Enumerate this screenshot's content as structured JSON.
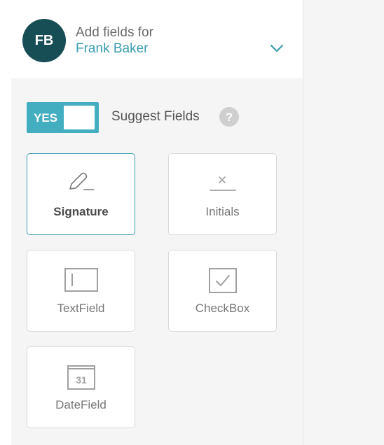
{
  "header": {
    "avatar_initials": "FB",
    "label": "Add fields for",
    "recipient_name": "Frank Baker",
    "dropdown_icon": "chevron-down-icon"
  },
  "suggest": {
    "toggle_label": "YES",
    "toggle_state": true,
    "label": "Suggest Fields",
    "help_icon_glyph": "?"
  },
  "fields": [
    {
      "label": "Signature",
      "icon": "signature-pen-icon",
      "selected": true
    },
    {
      "label": "Initials",
      "icon": "initials-icon",
      "selected": false
    },
    {
      "label": "TextField",
      "icon": "text-field-icon",
      "selected": false
    },
    {
      "label": "CheckBox",
      "icon": "checkbox-icon",
      "selected": false
    },
    {
      "label": "DateField",
      "icon": "calendar-icon",
      "selected": false,
      "icon_text": "31"
    }
  ],
  "colors": {
    "accent": "#43aec0",
    "name_text": "#3a9db1",
    "avatar_bg": "#174d55",
    "panel_bg": "#f5f5f5"
  }
}
